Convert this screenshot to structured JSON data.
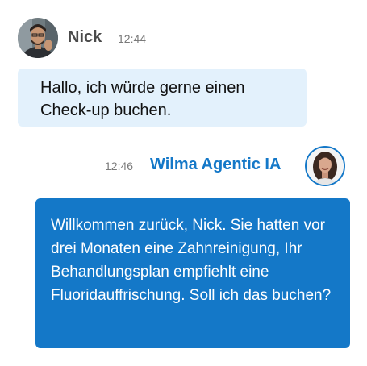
{
  "messages": [
    {
      "sender": "Nick",
      "time": "12:44",
      "text": "Hallo, ich würde gerne einen Check-up buchen."
    },
    {
      "sender": "Wilma Agentic IA",
      "time": "12:46",
      "text": "Willkommen zurück, Nick. Sie hatten vor drei Monaten eine Zahnreinigung, Ihr Behandlungsplan empfiehlt eine Fluoridauffrischung. Soll ich das buchen?"
    }
  ],
  "colors": {
    "user_bubble": "#e3f1fc",
    "agent_bubble": "#1478c8",
    "agent_name": "#1478c8",
    "user_name": "#4a4a4a"
  },
  "icons": {
    "user_avatar": "user-avatar-photo",
    "agent_avatar": "agent-avatar-photo"
  }
}
